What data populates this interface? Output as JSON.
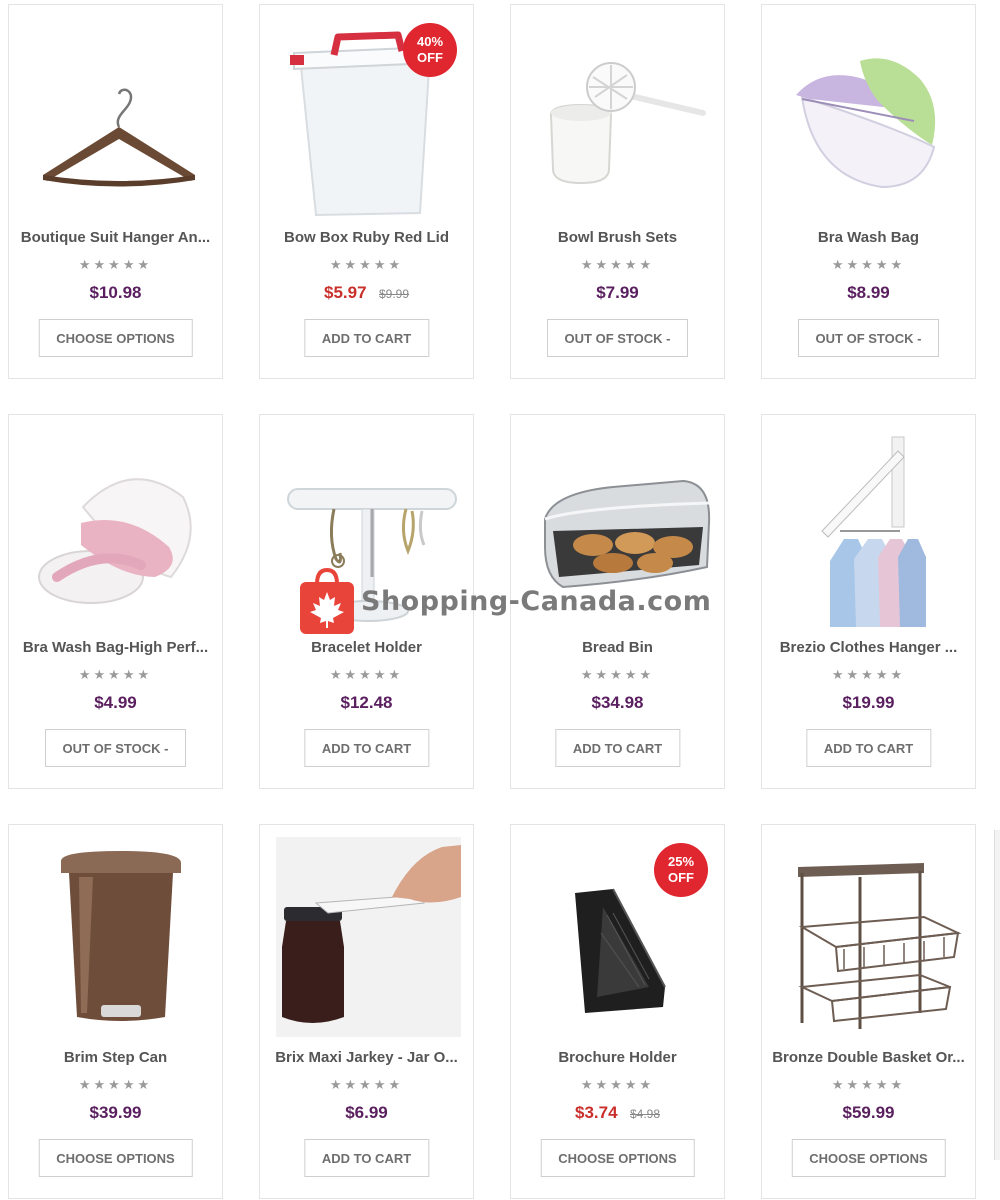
{
  "products": [
    {
      "name": "Boutique Suit Hanger An...",
      "price": "$10.98",
      "button": "CHOOSE OPTIONS",
      "rating": "★★★★★",
      "icon": "hanger-image"
    },
    {
      "name": "Bow Box Ruby Red Lid",
      "price": "$5.97",
      "old_price": "$9.99",
      "badge": {
        "line1": "40%",
        "line2": "OFF"
      },
      "button": "ADD TO CART",
      "rating": "★★★★★",
      "icon": "storage-box-image"
    },
    {
      "name": "Bowl Brush Sets",
      "price": "$7.99",
      "button": "OUT OF STOCK -",
      "rating": "★★★★★",
      "icon": "toilet-brush-image"
    },
    {
      "name": "Bra Wash Bag",
      "price": "$8.99",
      "button": "OUT OF STOCK -",
      "rating": "★★★★★",
      "icon": "wash-bag-image"
    },
    {
      "name": "Bra Wash Bag-High Perf...",
      "price": "$4.99",
      "button": "OUT OF STOCK -",
      "rating": "★★★★★",
      "icon": "wash-bag-pink-image"
    },
    {
      "name": "Bracelet Holder",
      "price": "$12.48",
      "button": "ADD TO CART",
      "rating": "★★★★★",
      "icon": "bracelet-holder-image"
    },
    {
      "name": "Bread Bin",
      "price": "$34.98",
      "button": "ADD TO CART",
      "rating": "★★★★★",
      "icon": "bread-bin-image"
    },
    {
      "name": "Brezio Clothes Hanger ...",
      "price": "$19.99",
      "button": "ADD TO CART",
      "rating": "★★★★★",
      "icon": "wall-hanger-image"
    },
    {
      "name": "Brim Step Can",
      "price": "$39.99",
      "button": "CHOOSE OPTIONS",
      "rating": "★★★★★",
      "icon": "step-can-image"
    },
    {
      "name": "Brix Maxi Jarkey - Jar O...",
      "price": "$6.99",
      "button": "ADD TO CART",
      "rating": "★★★★★",
      "icon": "jar-opener-image"
    },
    {
      "name": "Brochure Holder",
      "price": "$3.74",
      "old_price": "$4.98",
      "badge": {
        "line1": "25%",
        "line2": "OFF"
      },
      "button": "CHOOSE OPTIONS",
      "rating": "★★★★★",
      "icon": "brochure-holder-image"
    },
    {
      "name": "Bronze Double Basket Or...",
      "price": "$59.99",
      "button": "CHOOSE OPTIONS",
      "rating": "★★★★★",
      "icon": "basket-organizer-image"
    }
  ],
  "watermark": {
    "text": "Shopping-Canada.com"
  },
  "colors": {
    "price": "#5a1f5f",
    "sale_price": "#c9302c",
    "badge": "#e0262e",
    "logo": "#e8443a"
  }
}
